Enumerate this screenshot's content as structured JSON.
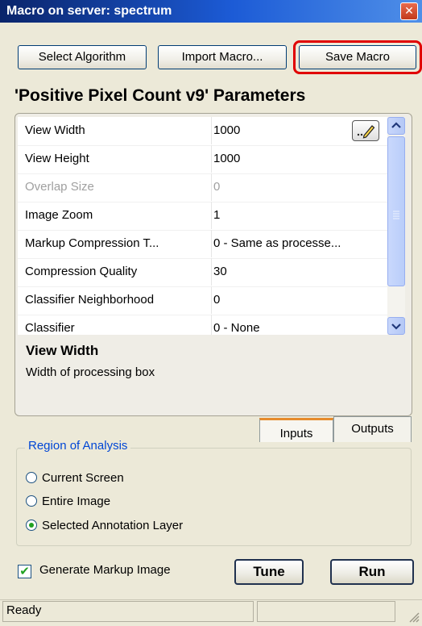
{
  "window": {
    "title": "Macro on server: spectrum",
    "close_glyph": "✕"
  },
  "toolbar": {
    "select_algorithm": "Select Algorithm",
    "import_macro": "Import Macro...",
    "save_macro": "Save Macro"
  },
  "params_title": "'Positive Pixel Count v9'  Parameters",
  "properties": [
    {
      "name": "View Width",
      "value": "1000",
      "enabled": true
    },
    {
      "name": "View Height",
      "value": "1000",
      "enabled": true
    },
    {
      "name": "Overlap Size",
      "value": "0",
      "enabled": false
    },
    {
      "name": "Image Zoom",
      "value": "1",
      "enabled": true
    },
    {
      "name": "Markup Compression T...",
      "value": "0 - Same as processe...",
      "enabled": true
    },
    {
      "name": "Compression Quality",
      "value": "30",
      "enabled": true
    },
    {
      "name": "Classifier Neighborhood",
      "value": "0",
      "enabled": true
    },
    {
      "name": "Classifier",
      "value": "0 - None",
      "enabled": true
    }
  ],
  "description": {
    "title": "View Width",
    "text": "Width of processing box"
  },
  "tabs": {
    "inputs": "Inputs",
    "outputs": "Outputs"
  },
  "region": {
    "legend": "Region of Analysis",
    "options": [
      "Current Screen",
      "Entire Image",
      "Selected Annotation Layer"
    ],
    "selected": "Selected Annotation Layer"
  },
  "generate_markup": {
    "label": "Generate Markup Image",
    "checked": true
  },
  "actions": {
    "tune": "Tune",
    "run": "Run"
  },
  "status": {
    "text": "Ready"
  },
  "colors": {
    "highlight": "#e00000",
    "title_bar": "#0a246a",
    "legend": "#0046d5"
  }
}
